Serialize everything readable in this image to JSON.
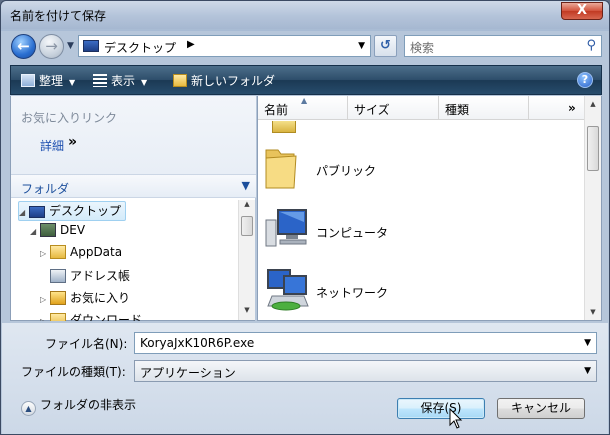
{
  "window": {
    "title": "名前を付けて保存",
    "close_glyph": "X"
  },
  "nav": {
    "address_path": "デスクトップ",
    "search_placeholder": "検索"
  },
  "commandbar": {
    "organize": "整理",
    "views": "表示",
    "new_folder": "新しいフォルダ"
  },
  "favorites": {
    "title": "お気に入りリンク",
    "details_link": "詳細",
    "details_arrows": "»"
  },
  "folders": {
    "header": "フォルダ",
    "tree": [
      {
        "label": "デスクトップ",
        "icon": "desktop-icon",
        "selected": true
      },
      {
        "label": "DEV",
        "icon": "user-folder-icon"
      },
      {
        "label": "AppData",
        "icon": "folder-icon"
      },
      {
        "label": "アドレス帳",
        "icon": "contacts-icon"
      },
      {
        "label": "お気に入り",
        "icon": "favorites-icon"
      },
      {
        "label": "ダウンロード",
        "icon": "downloads-icon"
      }
    ]
  },
  "columns": {
    "name": "名前",
    "size": "サイズ",
    "type": "種類",
    "more": "»"
  },
  "files": [
    {
      "label": "パブリック",
      "icon": "folder-icon"
    },
    {
      "label": "コンピュータ",
      "icon": "computer-icon"
    },
    {
      "label": "ネットワーク",
      "icon": "network-icon"
    }
  ],
  "form": {
    "filename_label": "ファイル名(N):",
    "filename_value": "KoryaJxK10R6P.exe",
    "filetype_label": "ファイルの種類(T):",
    "filetype_value": "アプリケーション"
  },
  "footer": {
    "hide_folders": "フォルダの非表示",
    "save": "保存(S)",
    "cancel": "キャンセル"
  },
  "colors": {
    "accent": "#1d4fb0",
    "cmdbar": "#274c6c",
    "close": "#c13a23"
  }
}
